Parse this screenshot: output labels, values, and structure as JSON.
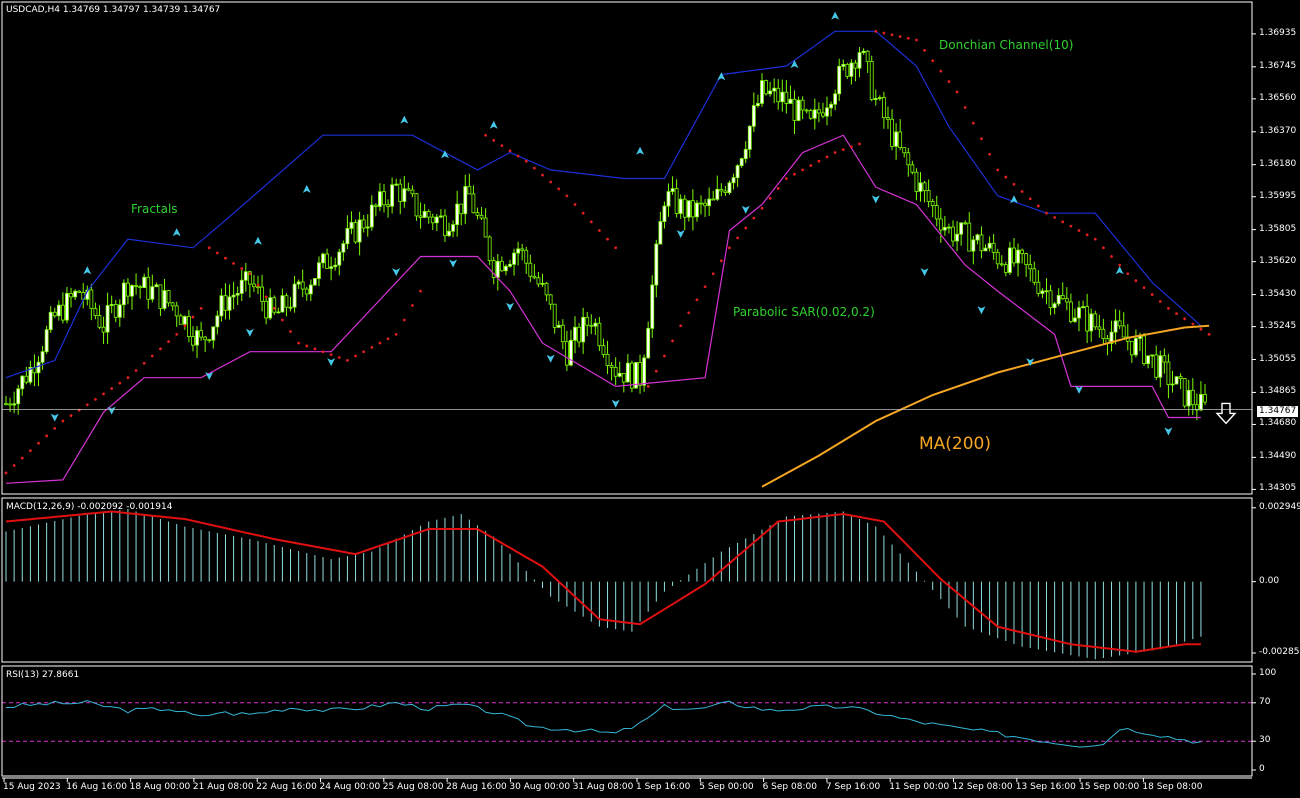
{
  "header": {
    "main": "USDCAD,H4  1.34769 1.34797 1.34739 1.34767",
    "macd": "MACD(12,26,9) -0.002092 -0.001914",
    "rsi": "RSI(13) 27.8661"
  },
  "annotations": {
    "fractals": "Fractals",
    "donchian": "Donchian Channel(10)",
    "sar": "Parabolic SAR(0.02,0.2)",
    "ma": "MA(200)"
  },
  "current_price": "1.34767",
  "colors": {
    "background": "#000000",
    "candle": "#7CFC00",
    "donchian_upper": "#1c2fd6",
    "donchian_lower": "#d633d6",
    "sar": "#e02020",
    "ma": "#f5a623",
    "macd_hist": "#8fdfe0",
    "macd_signal": "#e01010",
    "rsi": "#36b6d6",
    "rsi_levels": "#d633d6",
    "fractal": "#45c8e8"
  },
  "chart_data": [
    {
      "type": "candlestick",
      "symbol": "USDCAD",
      "timeframe": "H4",
      "y_ticks": [
        "1.36935",
        "1.36745",
        "1.36560",
        "1.36370",
        "1.36180",
        "1.35995",
        "1.35805",
        "1.35620",
        "1.35430",
        "1.35245",
        "1.35055",
        "1.34865",
        "1.34680",
        "1.34490",
        "1.34305"
      ],
      "ylim": [
        1.3429,
        1.3705
      ],
      "x_ticks": [
        "15 Aug 2023",
        "16 Aug 16:00",
        "18 Aug 00:00",
        "21 Aug 08:00",
        "22 Aug 16:00",
        "24 Aug 00:00",
        "25 Aug 08:00",
        "28 Aug 16:00",
        "30 Aug 00:00",
        "31 Aug 08:00",
        "1 Sep 16:00",
        "5 Sep 00:00",
        "6 Sep 08:00",
        "7 Sep 16:00",
        "11 Sep 00:00",
        "12 Sep 08:00",
        "13 Sep 16:00",
        "15 Sep 00:00",
        "18 Sep 08:00"
      ],
      "close_path": [
        [
          0,
          1.348
        ],
        [
          6,
          1.35
        ],
        [
          12,
          1.353
        ],
        [
          18,
          1.3545
        ],
        [
          24,
          1.3525
        ],
        [
          30,
          1.355
        ],
        [
          36,
          1.3545
        ],
        [
          42,
          1.3535
        ],
        [
          48,
          1.3515
        ],
        [
          54,
          1.354
        ],
        [
          60,
          1.355
        ],
        [
          66,
          1.353
        ],
        [
          72,
          1.3545
        ],
        [
          78,
          1.356
        ],
        [
          84,
          1.3575
        ],
        [
          90,
          1.359
        ],
        [
          96,
          1.3605
        ],
        [
          102,
          1.359
        ],
        [
          108,
          1.3585
        ],
        [
          114,
          1.36
        ],
        [
          120,
          1.356
        ],
        [
          126,
          1.357
        ],
        [
          132,
          1.3545
        ],
        [
          138,
          1.351
        ],
        [
          144,
          1.353
        ],
        [
          150,
          1.35
        ],
        [
          156,
          1.3495
        ],
        [
          162,
          1.36
        ],
        [
          168,
          1.359
        ],
        [
          174,
          1.3595
        ],
        [
          180,
          1.362
        ],
        [
          186,
          1.366
        ],
        [
          192,
          1.3655
        ],
        [
          198,
          1.364
        ],
        [
          204,
          1.3665
        ],
        [
          210,
          1.3685
        ],
        [
          214,
          1.3655
        ],
        [
          220,
          1.3625
        ],
        [
          226,
          1.36
        ],
        [
          232,
          1.358
        ],
        [
          238,
          1.3575
        ],
        [
          244,
          1.3565
        ],
        [
          250,
          1.356
        ],
        [
          256,
          1.3545
        ],
        [
          262,
          1.3535
        ],
        [
          268,
          1.3525
        ],
        [
          274,
          1.352
        ],
        [
          280,
          1.351
        ],
        [
          286,
          1.3495
        ],
        [
          290,
          1.3485
        ],
        [
          295,
          1.3477
        ]
      ],
      "n_candles": 296,
      "donchian_upper": [
        [
          0,
          1.3495
        ],
        [
          12,
          1.3505
        ],
        [
          20,
          1.3545
        ],
        [
          30,
          1.3575
        ],
        [
          46,
          1.357
        ],
        [
          56,
          1.359
        ],
        [
          78,
          1.3635
        ],
        [
          100,
          1.3635
        ],
        [
          116,
          1.3615
        ],
        [
          124,
          1.3625
        ],
        [
          134,
          1.3615
        ],
        [
          152,
          1.361
        ],
        [
          162,
          1.361
        ],
        [
          176,
          1.367
        ],
        [
          192,
          1.3675
        ],
        [
          204,
          1.3695
        ],
        [
          214,
          1.3695
        ],
        [
          224,
          1.3675
        ],
        [
          232,
          1.364
        ],
        [
          244,
          1.36
        ],
        [
          256,
          1.359
        ],
        [
          268,
          1.359
        ],
        [
          282,
          1.355
        ],
        [
          294,
          1.3525
        ]
      ],
      "donchian_lower": [
        [
          0,
          1.3434
        ],
        [
          14,
          1.3436
        ],
        [
          24,
          1.3475
        ],
        [
          34,
          1.3495
        ],
        [
          48,
          1.3495
        ],
        [
          60,
          1.351
        ],
        [
          80,
          1.351
        ],
        [
          102,
          1.3565
        ],
        [
          116,
          1.3565
        ],
        [
          124,
          1.3545
        ],
        [
          132,
          1.3515
        ],
        [
          150,
          1.349
        ],
        [
          172,
          1.3495
        ],
        [
          178,
          1.358
        ],
        [
          186,
          1.3595
        ],
        [
          196,
          1.3625
        ],
        [
          206,
          1.3635
        ],
        [
          214,
          1.3605
        ],
        [
          224,
          1.3595
        ],
        [
          236,
          1.356
        ],
        [
          244,
          1.3545
        ],
        [
          258,
          1.352
        ],
        [
          262,
          1.349
        ],
        [
          282,
          1.349
        ],
        [
          286,
          1.3472
        ],
        [
          294,
          1.3472
        ]
      ],
      "ma200": [
        [
          186,
          1.3432
        ],
        [
          200,
          1.345
        ],
        [
          214,
          1.347
        ],
        [
          228,
          1.3485
        ],
        [
          244,
          1.3498
        ],
        [
          260,
          1.3508
        ],
        [
          276,
          1.3518
        ],
        [
          290,
          1.3524
        ],
        [
          296,
          1.3525
        ]
      ],
      "sar_segments": [
        [
          [
            0,
            1.344
          ],
          [
            14,
            1.347
          ],
          [
            30,
            1.3495
          ],
          [
            42,
            1.352
          ],
          [
            48,
            1.3535
          ]
        ],
        [
          [
            50,
            1.357
          ],
          [
            60,
            1.3555
          ],
          [
            72,
            1.3515
          ],
          [
            84,
            1.3505
          ],
          [
            96,
            1.352
          ],
          [
            102,
            1.3545
          ]
        ],
        [
          [
            118,
            1.3635
          ],
          [
            128,
            1.362
          ],
          [
            138,
            1.36
          ],
          [
            150,
            1.357
          ]
        ],
        [
          [
            158,
            1.349
          ],
          [
            166,
            1.3525
          ],
          [
            178,
            1.357
          ],
          [
            192,
            1.361
          ],
          [
            204,
            1.3625
          ],
          [
            210,
            1.363
          ]
        ],
        [
          [
            214,
            1.3695
          ],
          [
            224,
            1.369
          ],
          [
            234,
            1.366
          ],
          [
            244,
            1.3615
          ],
          [
            256,
            1.359
          ],
          [
            268,
            1.3575
          ],
          [
            276,
            1.3555
          ],
          [
            286,
            1.3535
          ],
          [
            296,
            1.352
          ]
        ]
      ],
      "fractals_up": [
        [
          20,
          1.3553
        ],
        [
          42,
          1.3575
        ],
        [
          62,
          1.357
        ],
        [
          74,
          1.36
        ],
        [
          98,
          1.364
        ],
        [
          108,
          1.362
        ],
        [
          120,
          1.3637
        ],
        [
          156,
          1.3622
        ],
        [
          176,
          1.3665
        ],
        [
          194,
          1.3672
        ],
        [
          204,
          1.37
        ],
        [
          248,
          1.3594
        ],
        [
          274,
          1.3553
        ]
      ],
      "fractals_down": [
        [
          12,
          1.3476
        ],
        [
          26,
          1.348
        ],
        [
          50,
          1.35
        ],
        [
          60,
          1.3525
        ],
        [
          80,
          1.3508
        ],
        [
          96,
          1.356
        ],
        [
          110,
          1.3565
        ],
        [
          124,
          1.354
        ],
        [
          134,
          1.351
        ],
        [
          150,
          1.3484
        ],
        [
          166,
          1.3582
        ],
        [
          182,
          1.3596
        ],
        [
          214,
          1.3602
        ],
        [
          226,
          1.356
        ],
        [
          240,
          1.3538
        ],
        [
          252,
          1.3508
        ],
        [
          264,
          1.3492
        ],
        [
          286,
          1.3468
        ]
      ]
    },
    {
      "type": "macd",
      "params": "12,26,9",
      "y_ticks": [
        "0.002949",
        "0.00",
        "-0.00285"
      ],
      "ylim": [
        -0.00305,
        0.0031
      ],
      "histogram": [
        [
          0,
          0.002
        ],
        [
          20,
          0.0027
        ],
        [
          30,
          0.0029
        ],
        [
          44,
          0.0022
        ],
        [
          60,
          0.0017
        ],
        [
          80,
          0.0009
        ],
        [
          90,
          0.0012
        ],
        [
          104,
          0.0024
        ],
        [
          112,
          0.0027
        ],
        [
          120,
          0.0018
        ],
        [
          134,
          -0.0006
        ],
        [
          146,
          -0.0018
        ],
        [
          154,
          -0.002
        ],
        [
          162,
          -0.0004
        ],
        [
          176,
          0.0012
        ],
        [
          192,
          0.0026
        ],
        [
          206,
          0.0028
        ],
        [
          214,
          0.0022
        ],
        [
          224,
          0.0004
        ],
        [
          236,
          -0.0018
        ],
        [
          250,
          -0.0026
        ],
        [
          268,
          -0.0031
        ],
        [
          284,
          -0.0027
        ],
        [
          296,
          -0.0021
        ]
      ],
      "signal": [
        [
          0,
          0.0024
        ],
        [
          26,
          0.0028
        ],
        [
          44,
          0.0025
        ],
        [
          66,
          0.0017
        ],
        [
          86,
          0.0011
        ],
        [
          104,
          0.0021
        ],
        [
          116,
          0.0021
        ],
        [
          132,
          0.0006
        ],
        [
          146,
          -0.0015
        ],
        [
          156,
          -0.0017
        ],
        [
          172,
          -0.0001
        ],
        [
          190,
          0.0024
        ],
        [
          206,
          0.0027
        ],
        [
          216,
          0.0024
        ],
        [
          230,
          0.0001
        ],
        [
          244,
          -0.0018
        ],
        [
          262,
          -0.0025
        ],
        [
          278,
          -0.0028
        ],
        [
          290,
          -0.0025
        ],
        [
          296,
          -0.0025
        ]
      ]
    },
    {
      "type": "rsi",
      "period": 13,
      "y_ticks": [
        "100",
        "70",
        "30",
        "0"
      ],
      "ylim": [
        0,
        100
      ],
      "levels": [
        70,
        30
      ],
      "values": [
        [
          0,
          66
        ],
        [
          10,
          69
        ],
        [
          20,
          70
        ],
        [
          30,
          62
        ],
        [
          40,
          64
        ],
        [
          48,
          55
        ],
        [
          52,
          60
        ],
        [
          60,
          58
        ],
        [
          70,
          65
        ],
        [
          80,
          62
        ],
        [
          90,
          66
        ],
        [
          96,
          70
        ],
        [
          104,
          64
        ],
        [
          112,
          68
        ],
        [
          120,
          60
        ],
        [
          130,
          45
        ],
        [
          140,
          42
        ],
        [
          150,
          38
        ],
        [
          156,
          48
        ],
        [
          162,
          66
        ],
        [
          170,
          63
        ],
        [
          178,
          70
        ],
        [
          188,
          62
        ],
        [
          198,
          65
        ],
        [
          206,
          66
        ],
        [
          214,
          60
        ],
        [
          222,
          52
        ],
        [
          232,
          45
        ],
        [
          244,
          38
        ],
        [
          256,
          30
        ],
        [
          264,
          26
        ],
        [
          270,
          27
        ],
        [
          274,
          44
        ],
        [
          280,
          40
        ],
        [
          288,
          33
        ],
        [
          296,
          28
        ]
      ]
    }
  ]
}
